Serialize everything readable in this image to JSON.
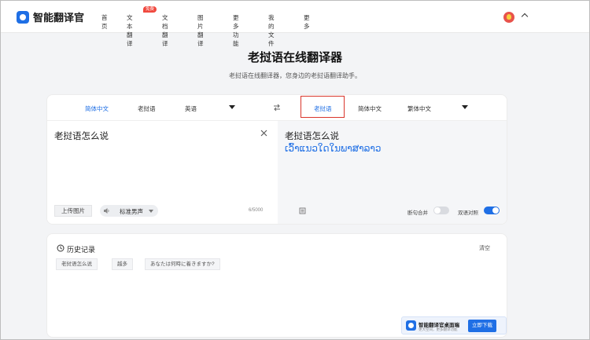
{
  "header": {
    "app_name": "智能翻译官",
    "nav": [
      {
        "label": "首页"
      },
      {
        "label": "文本翻译",
        "badge": "免费"
      },
      {
        "label": "文档翻译"
      },
      {
        "label": "图片翻译"
      },
      {
        "label": "更多功能"
      },
      {
        "label": "我的文件"
      },
      {
        "label": "更多"
      }
    ],
    "avatar_icon": "user-avatar-icon"
  },
  "hero": {
    "title": "老挝语在线翻译器",
    "subtitle": "老挝语在线翻译器，您身边的老挝语翻译助手。"
  },
  "translator": {
    "source_langs": [
      "简体中文",
      "老挝语",
      "英语"
    ],
    "source_active_index": 0,
    "target_langs": [
      "老挝语",
      "简体中文",
      "繁体中文"
    ],
    "target_active_index": 0,
    "source_text": "老挝语怎么说",
    "upload_label": "上传图片",
    "voice_label": "标准男声",
    "char_count": "6/5000",
    "translated_text": "老挝语怎么说",
    "translated_lao": "ເວົ້າແນວໃດໃນພາສາລາວ",
    "sentence_merge_label": "断句合并",
    "sentence_merge_on": false,
    "bilingual_label": "双语对照",
    "bilingual_on": true,
    "accent_color": "#1f6fe5",
    "highlight_color": "#d9352b"
  },
  "history": {
    "title": "历史记录",
    "clear_label": "清空",
    "items": [
      "老挝语怎么说",
      "越多",
      "あなたは何時に着きますか?"
    ]
  },
  "promo": {
    "title": "智能翻译官桌面端",
    "subtitle": "更大空间，更多翻译功能",
    "button_label": "立即下载"
  }
}
